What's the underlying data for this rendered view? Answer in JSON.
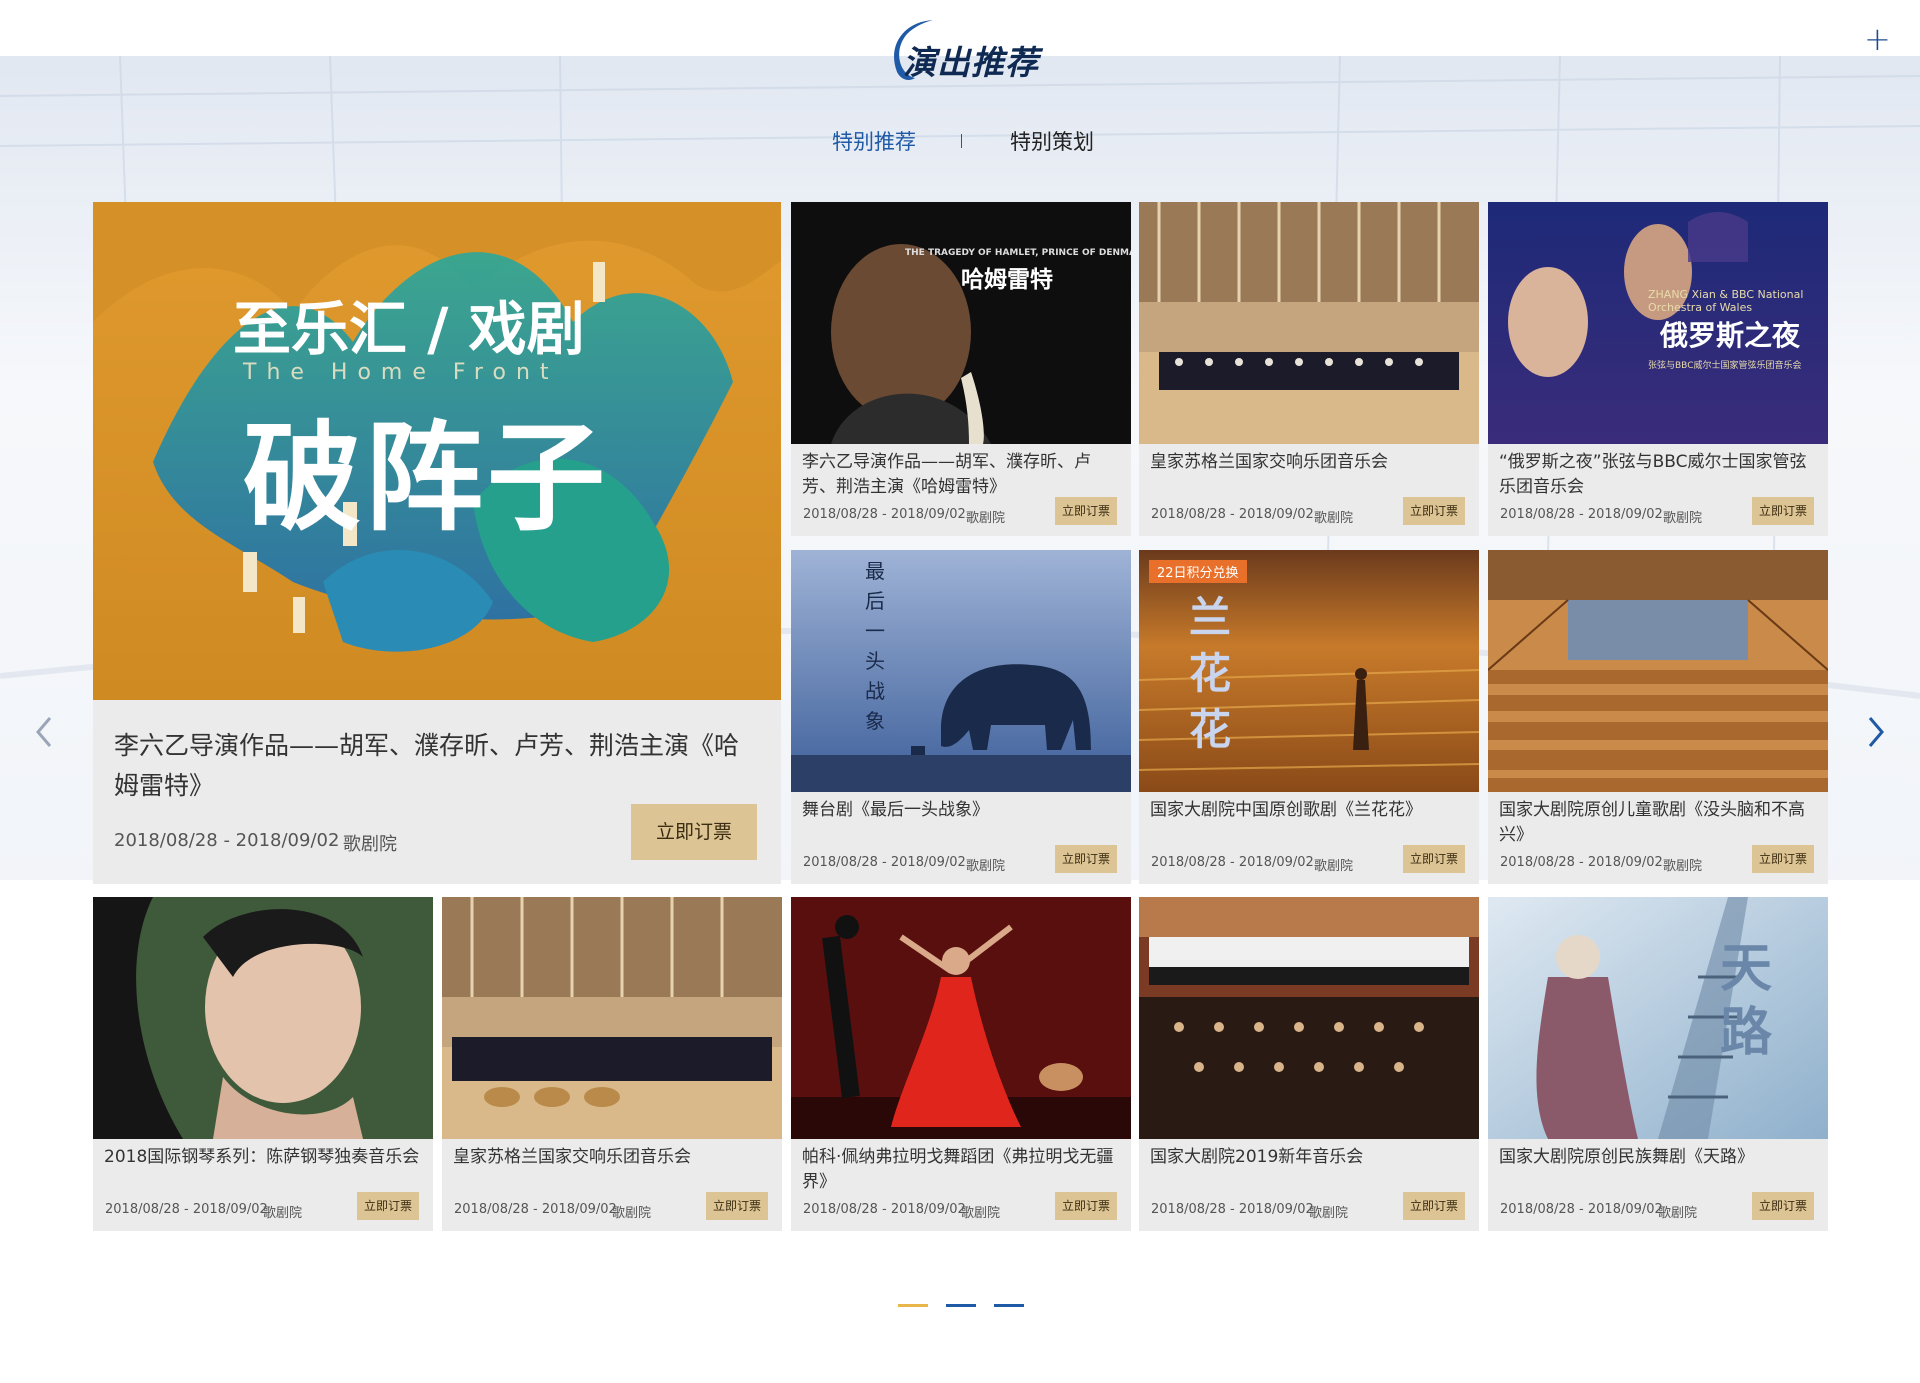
{
  "header": {
    "title": "演出推荐",
    "more_icon": "plus-icon",
    "more_symbol": "+"
  },
  "tabs": [
    {
      "label": "特别推荐",
      "active": true
    },
    {
      "label": "特别策划",
      "active": false
    }
  ],
  "colors": {
    "accent_blue": "#1f5aa6",
    "button_gold": "#dcc494",
    "active_dot": "#e8b64a",
    "card_bg": "#ebebeb"
  },
  "featured": {
    "poster_text": [
      "至乐汇 / 戏剧",
      "破阵子",
      "The Home Front"
    ],
    "title": "李六乙导演作品——胡军、濮存昕、卢芳、荆浩主演《哈姆雷特》",
    "date": "2018/08/28 - 2018/09/02",
    "venue": "歌剧院",
    "button": "立即订票"
  },
  "cards": [
    {
      "title": "李六乙导演作品——胡军、濮存昕、卢芳、荆浩主演《哈姆雷特》",
      "date": "2018/08/28 - 2018/09/02",
      "venue": "歌剧院",
      "button": "立即订票",
      "poster_text": [
        "THE TRAGEDY OF HAMLET, PRINCE OF DENMARK",
        "哈姆雷特"
      ]
    },
    {
      "title": "皇家苏格兰国家交响乐团音乐会",
      "date": "2018/08/28 - 2018/09/02",
      "venue": "歌剧院",
      "button": "立即订票"
    },
    {
      "title": "“俄罗斯之夜”张弦与BBC威尔士国家管弦乐团音乐会",
      "date": "2018/08/28 - 2018/09/02",
      "venue": "歌剧院",
      "button": "立即订票",
      "poster_text": [
        "ZHANG Xian & BBC National Orchestra of Wales",
        "俄罗斯之夜",
        "张弦与BBC威尔士国家管弦乐团音乐会"
      ]
    },
    {
      "title": "舞台剧《最后一头战象》",
      "date": "2018/08/28 - 2018/09/02",
      "venue": "歌剧院",
      "button": "立即订票",
      "poster_text": [
        "最后一头战象"
      ]
    },
    {
      "title": "国家大剧院中国原创歌剧《兰花花》",
      "date": "2018/08/28 - 2018/09/02",
      "venue": "歌剧院",
      "button": "立即订票",
      "badge": "22日积分兑换",
      "poster_text": [
        "兰花花"
      ]
    },
    {
      "title": "国家大剧院原创儿童歌剧《没头脑和不高兴》",
      "date": "2018/08/28 - 2018/09/02",
      "venue": "歌剧院",
      "button": "立即订票"
    },
    {
      "title": "2018国际钢琴系列：陈萨钢琴独奏音乐会",
      "date": "2018/08/28 - 2018/09/02",
      "venue": "歌剧院",
      "button": "立即订票"
    },
    {
      "title": "皇家苏格兰国家交响乐团音乐会",
      "date": "2018/08/28 - 2018/09/02",
      "venue": "歌剧院",
      "button": "立即订票"
    },
    {
      "title": "帕科·佩纳弗拉明戈舞蹈团《弗拉明戈无疆界》",
      "date": "2018/08/28 - 2018/09/02",
      "venue": "歌剧院",
      "button": "立即订票"
    },
    {
      "title": "国家大剧院2019新年音乐会",
      "date": "2018/08/28 - 2018/09/02",
      "venue": "歌剧院",
      "button": "立即订票"
    },
    {
      "title": "国家大剧院原创民族舞剧《天路》",
      "date": "2018/08/28 - 2018/09/02",
      "venue": "歌剧院",
      "button": "立即订票",
      "poster_text": [
        "天路"
      ]
    }
  ],
  "pagination": {
    "pages": 3,
    "current": 1
  }
}
